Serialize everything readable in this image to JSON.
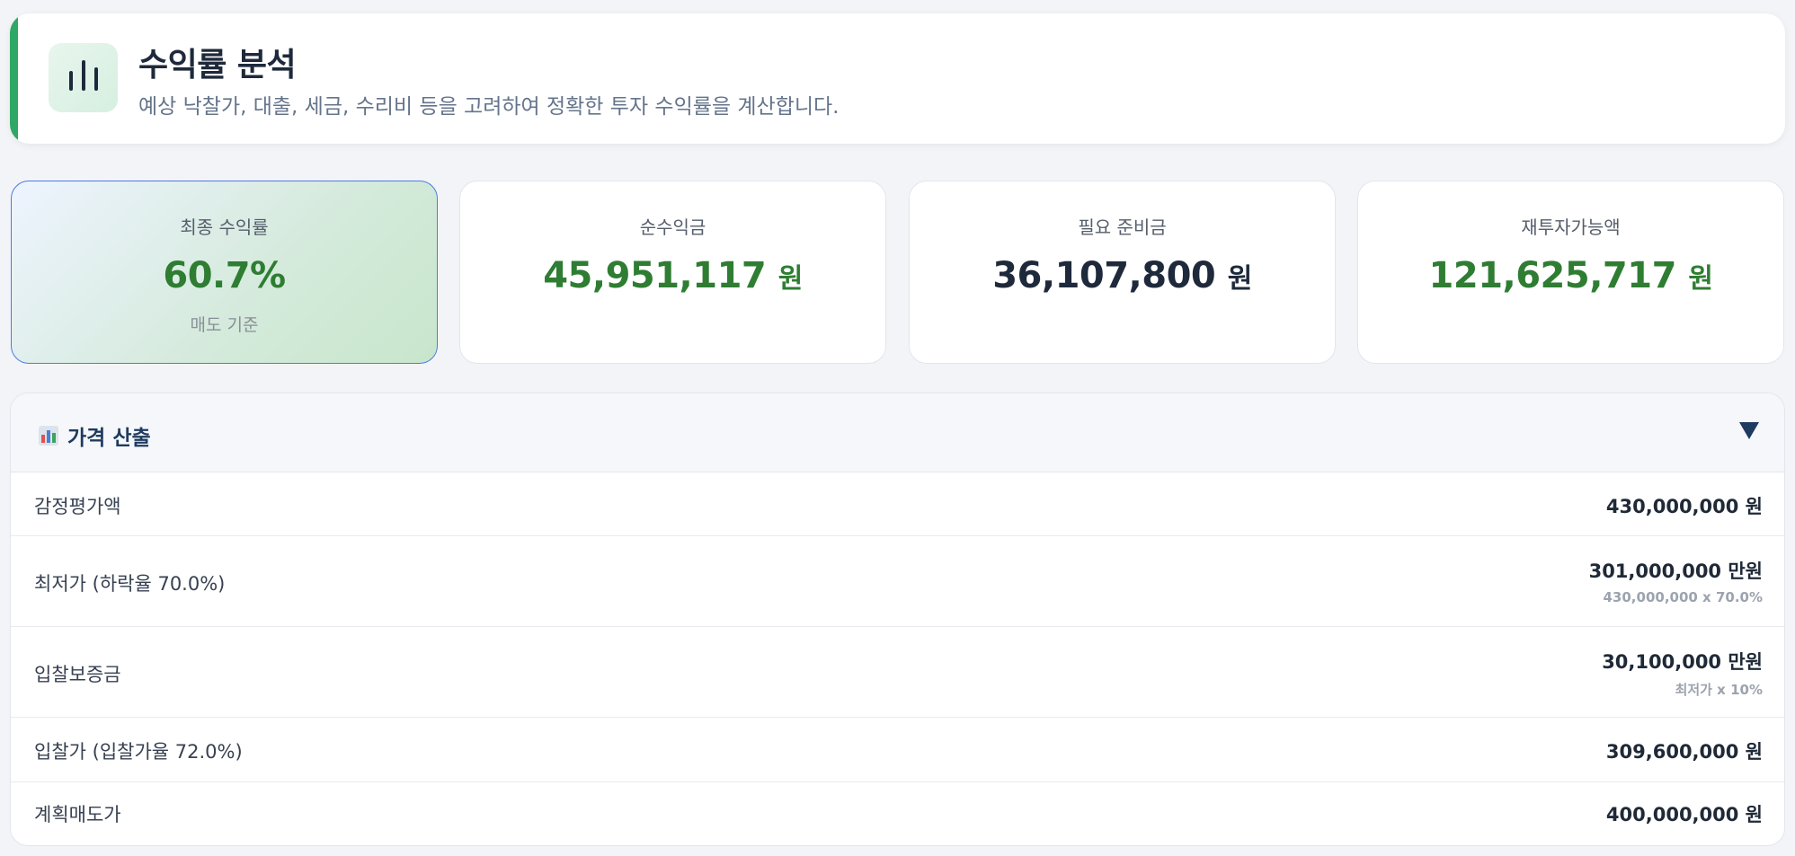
{
  "header": {
    "title": "수익률 분석",
    "subtitle": "예상 낙찰가, 대출, 세금, 수리비 등을 고려하여 정확한 투자 수익률을 계산합니다.",
    "accent_color": "#2fa765",
    "icon": "bar-chart-icon"
  },
  "stats": [
    {
      "label": "최종 수익률",
      "value": "60.7%",
      "unit": "",
      "foot": "매도 기준"
    },
    {
      "label": "순수익금",
      "value": "45,951,117",
      "unit": "원"
    },
    {
      "label": "필요 준비금",
      "value": "36,107,800",
      "unit": "원"
    },
    {
      "label": "재투자가능액",
      "value": "121,625,717",
      "unit": "원"
    }
  ],
  "price_section": {
    "title": "가격 산출",
    "icon": "chart-emoji-icon",
    "toggle_icon": "triangle-down-icon",
    "rows": [
      {
        "label": "감정평가액",
        "value": "430,000,000 원",
        "sub": ""
      },
      {
        "label": "최저가 (하락율 70.0%)",
        "value": "301,000,000 만원",
        "sub": "430,000,000 x 70.0%"
      },
      {
        "label": "입찰보증금",
        "value": "30,100,000 만원",
        "sub": "최저가 x 10%"
      },
      {
        "label": "입찰가 (입찰가율 72.0%)",
        "value": "309,600,000 원",
        "sub": ""
      },
      {
        "label": "계획매도가",
        "value": "400,000,000 원",
        "sub": ""
      }
    ]
  },
  "colors": {
    "positive": "#2e7d32",
    "dark": "#1e293b",
    "highlight_border": "#4b7be5"
  }
}
